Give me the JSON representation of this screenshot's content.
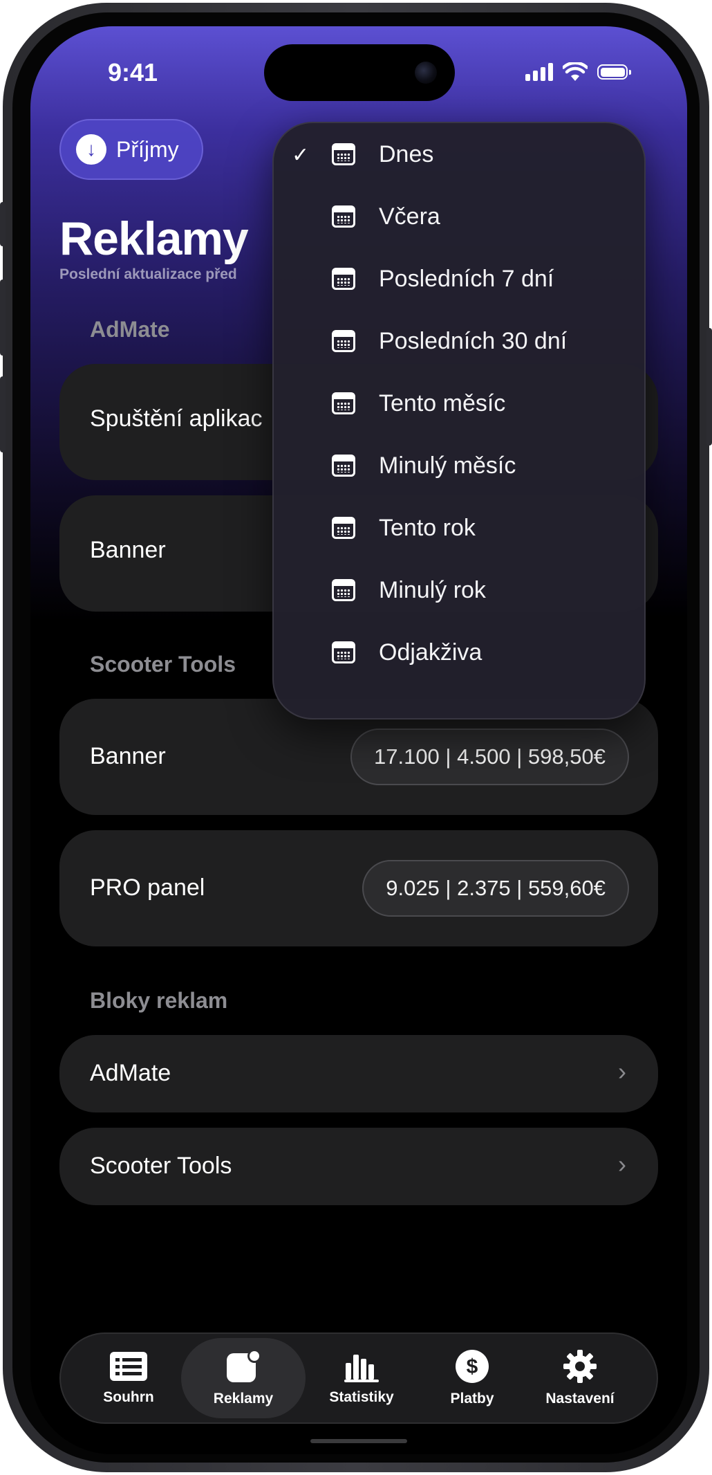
{
  "status_bar": {
    "time": "9:41"
  },
  "header": {
    "income_button": "Příjmy",
    "title": "Reklamy",
    "subtitle": "Poslední aktualizace před"
  },
  "sections": {
    "admate": {
      "heading": "AdMate",
      "rows": [
        {
          "label": "Spuštění aplikac"
        },
        {
          "label": "Banner"
        }
      ]
    },
    "scooter": {
      "heading": "Scooter Tools",
      "rows": [
        {
          "label": "Banner",
          "value": "17.100 | 4.500 | 598,50€"
        },
        {
          "label": "PRO panel",
          "value": "9.025 | 2.375 | 559,60€"
        }
      ]
    },
    "blocks": {
      "heading": "Bloky reklam",
      "rows": [
        {
          "label": "AdMate"
        },
        {
          "label": "Scooter Tools"
        }
      ]
    }
  },
  "date_menu": {
    "selected": "Dnes",
    "items": [
      {
        "label": "Dnes",
        "icon": "calendar-icon"
      },
      {
        "label": "Včera",
        "icon": "calendar-icon"
      },
      {
        "label": "Posledních 7 dní",
        "icon": "calendar-icon"
      },
      {
        "label": "Posledních 30 dní",
        "icon": "calendar-icon"
      },
      {
        "label": "Tento měsíc",
        "icon": "calendar-icon"
      },
      {
        "label": "Minulý měsíc",
        "icon": "calendar-icon"
      },
      {
        "label": "Tento rok",
        "icon": "calendar-icon"
      },
      {
        "label": "Minulý rok",
        "icon": "calendar-icon"
      },
      {
        "label": "Odjakživa",
        "icon": "calendar-icon"
      }
    ]
  },
  "tab_bar": {
    "active": "Reklamy",
    "tabs": [
      {
        "label": "Souhrn",
        "icon": "list-icon"
      },
      {
        "label": "Reklamy",
        "icon": "app-badge-icon"
      },
      {
        "label": "Statistiky",
        "icon": "bar-chart-icon"
      },
      {
        "label": "Platby",
        "icon": "dollar-icon"
      },
      {
        "label": "Nastavení",
        "icon": "gear-icon"
      }
    ]
  },
  "colors": {
    "accent": "#5046c8",
    "header_gradient_top": "#5c50d2",
    "card_bg": "#1f1f20",
    "section_text": "#8d8d92"
  }
}
